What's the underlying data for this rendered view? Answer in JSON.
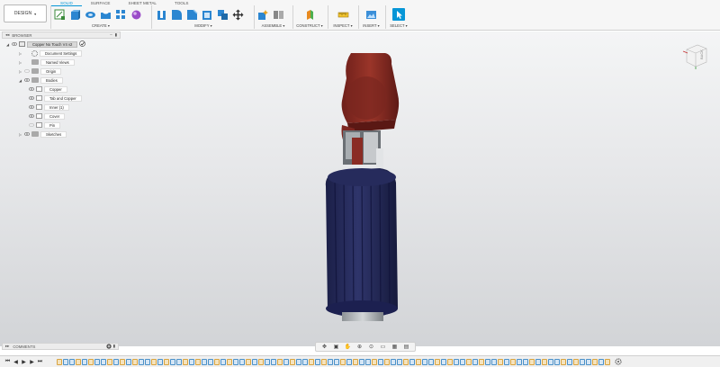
{
  "toolbar": {
    "design_label": "DESIGN",
    "tabs": [
      "SOLID",
      "SURFACE",
      "SHEET METAL",
      "TOOLS"
    ],
    "groups": {
      "create": "CREATE",
      "modify": "MODIFY",
      "assemble": "ASSEMBLE",
      "construct": "CONSTRUCT",
      "inspect": "INSPECT",
      "insert": "INSERT",
      "select": "SELECT"
    },
    "caret": "▾"
  },
  "browser": {
    "title": "BROWSER",
    "root": "Copper No Touch V4 v2",
    "items": {
      "document_settings": "Document Settings",
      "named_views": "Named Views",
      "origin": "Origin",
      "bodies": "Bodies",
      "copper": "Copper",
      "tab_and_copper": "Tab and Copper",
      "inner": "Inner (1)",
      "cover": "Cover",
      "pin": "Pin",
      "sketches": "Sketches"
    }
  },
  "viewcube": {
    "face": "BACK"
  },
  "comments": {
    "title": "COMMENTS"
  },
  "colors": {
    "accent": "#0696d7",
    "cap": "#8e2d25",
    "grip": "#262b5c",
    "pin": "#b4b9bc"
  },
  "timeline": {
    "item_colors": [
      "#d8a340",
      "#4a90c8",
      "#4a90c8",
      "#d8a340",
      "#4a90c8",
      "#d8a340",
      "#4a90c8",
      "#4a90c8",
      "#d8a340",
      "#4a90c8",
      "#d8a340",
      "#4a90c8",
      "#d8a340",
      "#4a90c8",
      "#4a90c8",
      "#d8a340",
      "#4a90c8",
      "#d8a340",
      "#4a90c8",
      "#4a90c8",
      "#d8a340",
      "#4a90c8",
      "#d8a340",
      "#4a90c8",
      "#4a90c8",
      "#d8a340",
      "#4a90c8",
      "#d8a340",
      "#4a90c8",
      "#4a90c8",
      "#d8a340",
      "#4a90c8",
      "#d8a340",
      "#4a90c8",
      "#4a90c8",
      "#d8a340",
      "#4a90c8",
      "#d8a340",
      "#4a90c8",
      "#4a90c8",
      "#d8a340",
      "#4a90c8",
      "#d8a340",
      "#4a90c8",
      "#4a90c8",
      "#d8a340",
      "#4a90c8",
      "#d8a340",
      "#4a90c8",
      "#4a90c8",
      "#d8a340",
      "#4a90c8",
      "#d8a340",
      "#4a90c8",
      "#4a90c8",
      "#d8a340",
      "#4a90c8",
      "#d8a340",
      "#4a90c8",
      "#4a90c8",
      "#d8a340",
      "#4a90c8",
      "#d8a340",
      "#4a90c8",
      "#4a90c8",
      "#d8a340",
      "#4a90c8",
      "#d8a340",
      "#4a90c8",
      "#4a90c8",
      "#d8a340",
      "#4a90c8",
      "#d8a340",
      "#4a90c8",
      "#4a90c8",
      "#d8a340",
      "#4a90c8",
      "#d8a340",
      "#4a90c8",
      "#4a90c8",
      "#d8a340",
      "#4a90c8",
      "#d8a340",
      "#4a90c8",
      "#4a90c8",
      "#d8a340",
      "#4a90c8",
      "#d8a340"
    ]
  }
}
